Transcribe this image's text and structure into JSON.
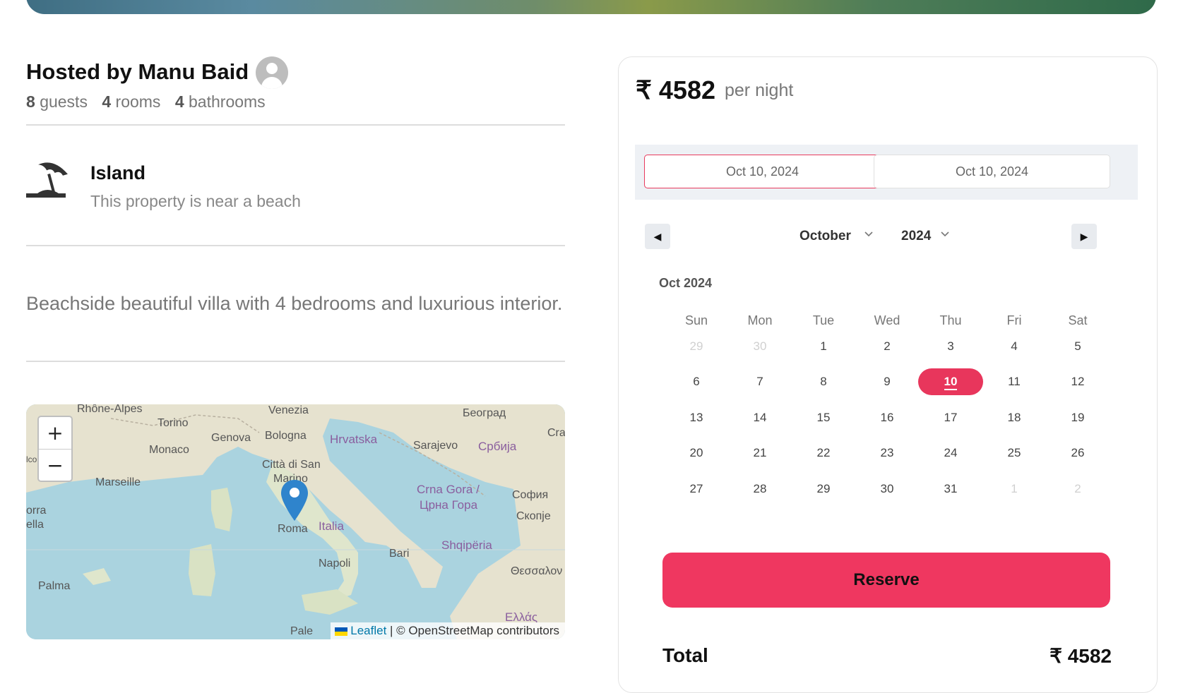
{
  "host": {
    "title": "Hosted by Manu Baid",
    "guests_count": "8",
    "guests_label": "guests",
    "rooms_count": "4",
    "rooms_label": "rooms",
    "bathrooms_count": "4",
    "bathrooms_label": "bathrooms"
  },
  "category": {
    "icon": "beach-umbrella-icon",
    "title": "Island",
    "description": "This property is near a beach"
  },
  "listing": {
    "description": "Beachside beautiful villa with 4 bedrooms and luxurious interior."
  },
  "map": {
    "zoom_in": "+",
    "zoom_out": "−",
    "attribution_link": "Leaflet",
    "attribution_text": "| © OpenStreetMap contributors",
    "labels": [
      "Rhône-Alpes",
      "Torino",
      "Venezia",
      "Београд",
      "Genova",
      "Bologna",
      "Hrvatska",
      "Cra",
      "Monaco",
      "Sarajevo",
      "Србија",
      "Città di San",
      "Marino",
      "Marseille",
      "Crna Gora /",
      "Црна Гора",
      "София",
      "orra",
      "ella",
      "Скопje",
      "Roma",
      "Italia",
      "Shqipëria",
      "Bari",
      "Napoli",
      "Palma",
      "Θεσσαλον",
      "Ελλάς",
      "Pale",
      "lco"
    ]
  },
  "booking": {
    "price": "₹ 4582",
    "per_night": "per night",
    "start_date": "Oct 10, 2024",
    "end_date": "Oct 10, 2024",
    "prev_icon": "◀",
    "next_icon": "▶",
    "month": "October",
    "year": "2024",
    "caption": "Oct 2024",
    "weekdays": [
      "Sun",
      "Mon",
      "Tue",
      "Wed",
      "Thu",
      "Fri",
      "Sat"
    ],
    "weeks": [
      [
        "29",
        "30",
        "1",
        "2",
        "3",
        "4",
        "5"
      ],
      [
        "6",
        "7",
        "8",
        "9",
        "10",
        "11",
        "12"
      ],
      [
        "13",
        "14",
        "15",
        "16",
        "17",
        "18",
        "19"
      ],
      [
        "20",
        "21",
        "22",
        "23",
        "24",
        "25",
        "26"
      ],
      [
        "27",
        "28",
        "29",
        "30",
        "31",
        "1",
        "2"
      ]
    ],
    "selected_day": "10",
    "reserve_label": "Reserve",
    "total_label": "Total",
    "total_value": "₹ 4582"
  },
  "colors": {
    "accent": "#ef3760",
    "selected_day": "#e8365c",
    "map_water": "#aad3df",
    "link": "#0078a8"
  }
}
